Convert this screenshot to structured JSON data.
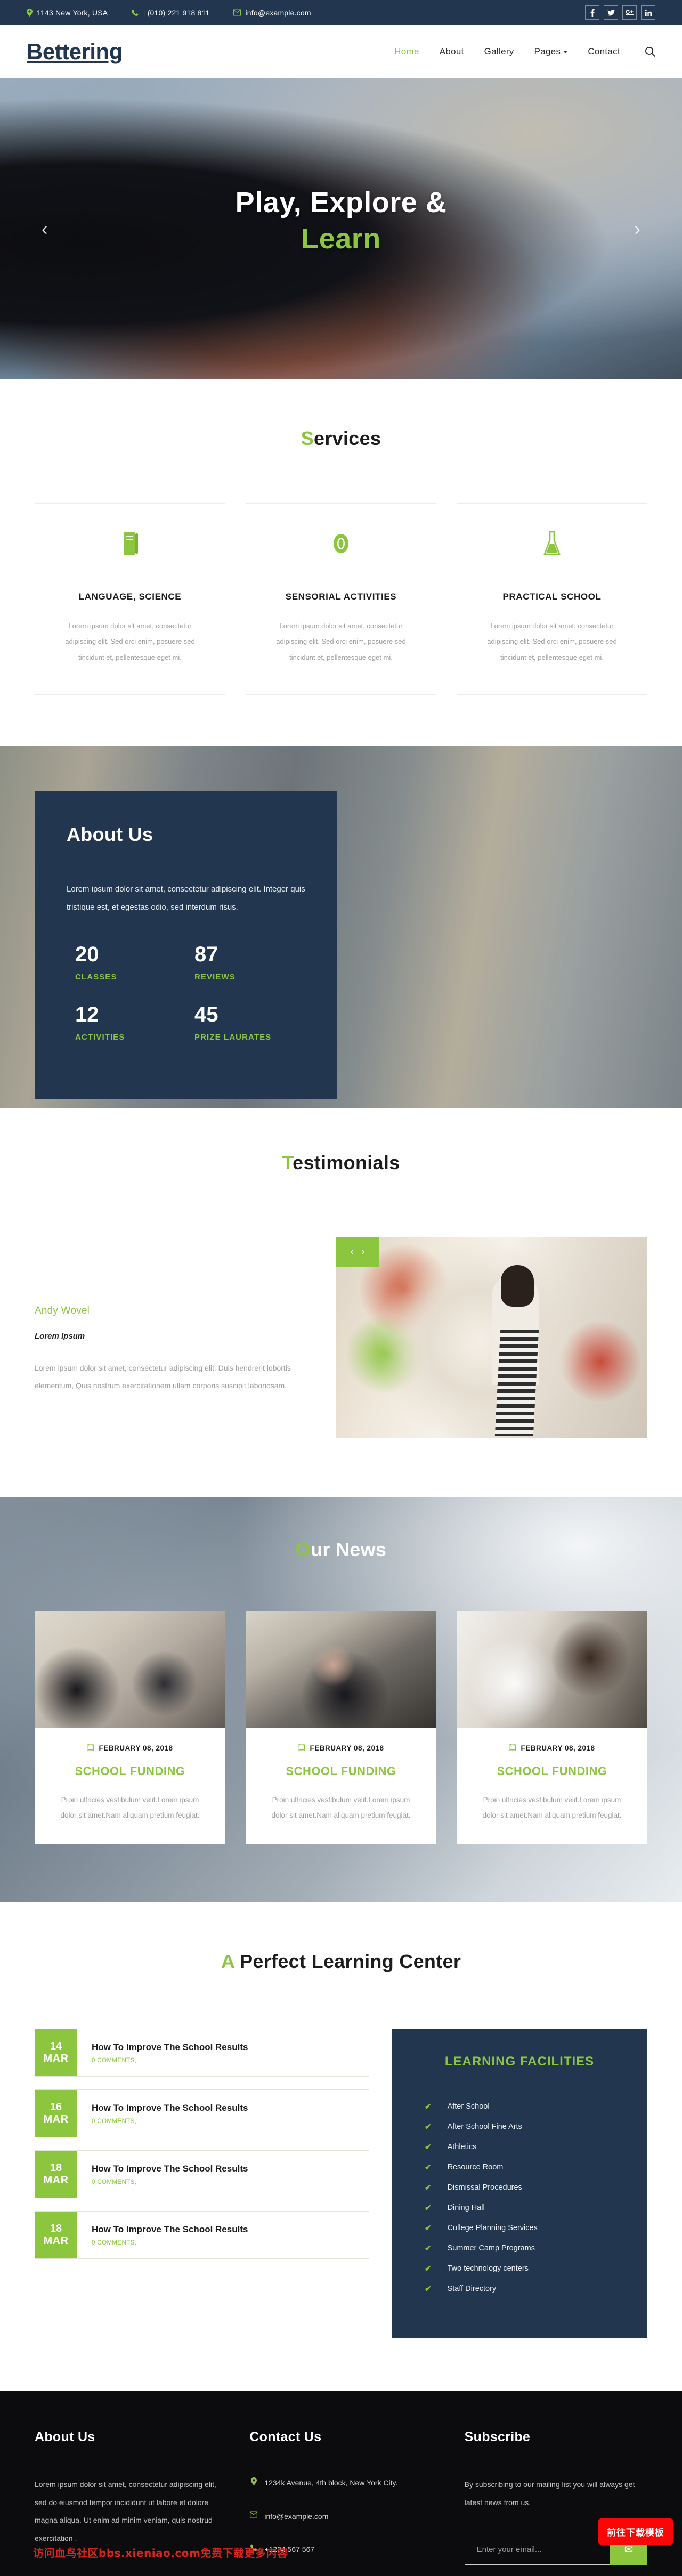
{
  "topbar": {
    "address": "1143 New York, USA",
    "phone": "+(010) 221 918 811",
    "email": "info@example.com",
    "social": [
      {
        "name": "facebook",
        "glyph": "f"
      },
      {
        "name": "twitter",
        "glyph": "ᵗ"
      },
      {
        "name": "google-plus",
        "glyph": "G+"
      },
      {
        "name": "linkedin",
        "glyph": "in"
      }
    ]
  },
  "nav": {
    "logo": "Bettering",
    "items": [
      {
        "label": "Home",
        "active": true
      },
      {
        "label": "About",
        "active": false
      },
      {
        "label": "Gallery",
        "active": false
      },
      {
        "label": "Pages",
        "active": false,
        "dropdown": true
      },
      {
        "label": "Contact",
        "active": false
      }
    ],
    "search_icon": "search-icon"
  },
  "hero": {
    "line1": "Play, Explore &",
    "line2": "Learn",
    "prev": "‹",
    "next": "›"
  },
  "services": {
    "title_first": "S",
    "title_rest": "ervices",
    "cards": [
      {
        "icon": "book-icon",
        "name": "LANGUAGE, SCIENCE",
        "text": "Lorem ipsum dolor sit amet, consectetur adipiscing elit. Sed orci enim, posuere sed tincidunt et, pellentesque eget mi."
      },
      {
        "icon": "eye-icon",
        "name": "SENSORIAL ACTIVITIES",
        "text": "Lorem ipsum dolor sit amet, consectetur adipiscing elit. Sed orci enim, posuere sed tincidunt et, pellentesque eget mi."
      },
      {
        "icon": "flask-icon",
        "name": "PRACTICAL SCHOOL",
        "text": "Lorem ipsum dolor sit amet, consectetur adipiscing elit. Sed orci enim, posuere sed tincidunt et, pellentesque eget mi."
      }
    ]
  },
  "about": {
    "title": "About Us",
    "text": "Lorem ipsum dolor sit amet, consectetur adipiscing elit. Integer quis tristique est, et egestas odio, sed interdum risus.",
    "stats": [
      {
        "num": "20",
        "label": "CLASSES"
      },
      {
        "num": "87",
        "label": "REVIEWS"
      },
      {
        "num": "12",
        "label": "ACTIVITIES"
      },
      {
        "num": "45",
        "label": "PRIZE LAURATES"
      }
    ]
  },
  "testimonials": {
    "title_first": "T",
    "title_rest": "estimonials",
    "author": "Andy Wovel",
    "subtitle": "Lorem Ipsum",
    "text": "Lorem ipsum dolor sit amet, consectetur adipiscing elit. Duis hendrerit lobortis elementum, Quis nostrum exercitationem ullam corporis suscipit laboriosam.",
    "prev": "‹",
    "next": "›"
  },
  "news": {
    "title_first": "O",
    "title_rest": "ur News",
    "cards": [
      {
        "date": "FEBRUARY 08, 2018",
        "title": "SCHOOL FUNDING",
        "text": "Proin ultricies vestibulum velit.Lorem ipsum dolor sit amet.Nam aliquam pretium feugiat."
      },
      {
        "date": "FEBRUARY 08, 2018",
        "title": "SCHOOL FUNDING",
        "text": "Proin ultricies vestibulum velit.Lorem ipsum dolor sit amet.Nam aliquam pretium feugiat."
      },
      {
        "date": "FEBRUARY 08, 2018",
        "title": "SCHOOL FUNDING",
        "text": "Proin ultricies vestibulum velit.Lorem ipsum dolor sit amet.Nam aliquam pretium feugiat."
      }
    ]
  },
  "learning": {
    "title_first": "A",
    "title_rest": " Perfect Learning Center",
    "posts": [
      {
        "day": "14",
        "month": "MAR",
        "title": "How To Improve The School Results",
        "meta": "0 COMMENTS,"
      },
      {
        "day": "16",
        "month": "MAR",
        "title": "How To Improve The School Results",
        "meta": "0 COMMENTS,"
      },
      {
        "day": "18",
        "month": "MAR",
        "title": "How To Improve The School Results",
        "meta": "0 COMMENTS,"
      },
      {
        "day": "18",
        "month": "MAR",
        "title": "How To Improve The School Results",
        "meta": "0 COMMENTS,"
      }
    ],
    "facilities_title": "LEARNING FACILITIES",
    "facilities": [
      "After School",
      "After School Fine Arts",
      "Athletics",
      "Resource Room",
      "Dismissal Procedures",
      "Dining Hall",
      "College Planning Services",
      "Summer Camp Programs",
      "Two technology centers",
      "Staff Directory"
    ]
  },
  "footer": {
    "about_title": "About Us",
    "about_text": "Lorem ipsum dolor sit amet, consectetur adipiscing elit, sed do eiusmod tempor incididunt ut labore et dolore magna aliqua. Ut enim ad minim veniam, quis nostrud exercitation .",
    "contact_title": "Contact Us",
    "contact": [
      {
        "icon": "map-pin-icon",
        "text": "1234k Avenue, 4th block, New York City."
      },
      {
        "icon": "envelope-icon",
        "text": "info@example.com"
      },
      {
        "icon": "phone-icon",
        "text": "+1234 567 567"
      }
    ],
    "subscribe_title": "Subscribe",
    "subscribe_text": "By subscribing to our mailing list you will always get latest news from us.",
    "email_placeholder": "Enter your email...",
    "submit_icon": "✉",
    "watermark": "访问血鸟社区bbs.xieniao.com免费下载更多内容",
    "download_badge": "前往下载模板"
  },
  "colors": {
    "navy": "#22374f",
    "green": "#8cc63e",
    "dark": "#0c0c0e",
    "red": "#fb0606"
  }
}
